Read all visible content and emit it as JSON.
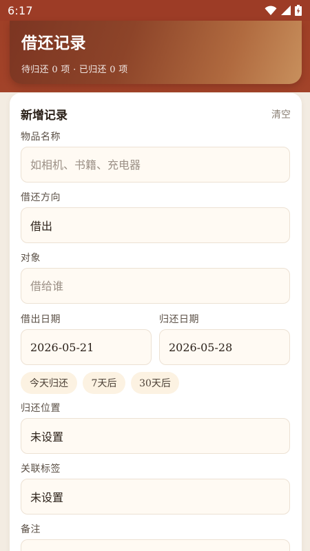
{
  "status_bar": {
    "time": "6:17",
    "icons": [
      "wifi-icon",
      "signal-icon",
      "battery-icon"
    ]
  },
  "header": {
    "title": "借还记录",
    "subtitle": "待归还 0 项 · 已归还 0 项"
  },
  "form": {
    "title": "新增记录",
    "clear_label": "清空",
    "item_name": {
      "label": "物品名称",
      "value": "",
      "placeholder": "如相机、书籍、充电器"
    },
    "direction": {
      "label": "借还方向",
      "value": "借出"
    },
    "counterpart": {
      "label": "对象",
      "value": "",
      "placeholder": "借给谁"
    },
    "lend_date": {
      "label": "借出日期",
      "value": "2026-05-21"
    },
    "return_date": {
      "label": "归还日期",
      "value": "2026-05-28"
    },
    "quick_chips": [
      "今天归还",
      "7天后",
      "30天后"
    ],
    "return_location": {
      "label": "归还位置",
      "value": "未设置"
    },
    "tags": {
      "label": "关联标签",
      "value": "未设置"
    },
    "notes": {
      "label": "备注",
      "value": ""
    }
  },
  "colors": {
    "brand": "#9d3c26",
    "field_bg": "#fffaf3",
    "chip_bg": "#fcf2e2"
  }
}
